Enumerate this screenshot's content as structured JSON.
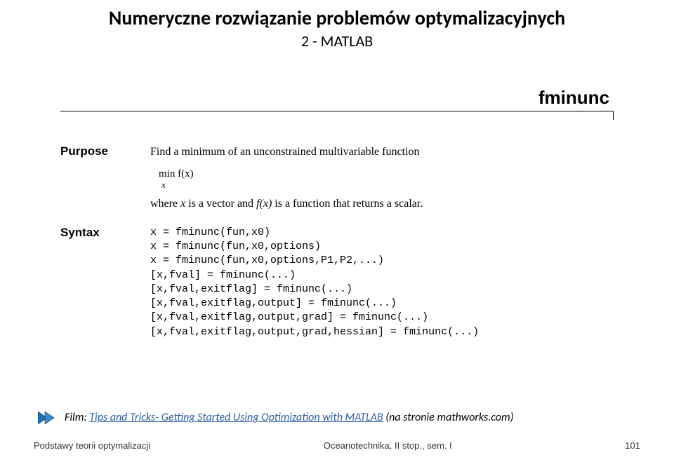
{
  "header": {
    "title": "Numeryczne rozwiązanie problemów optymalizacyjnych",
    "subtitle": "2 - MATLAB"
  },
  "doc": {
    "fn_name": "fminunc",
    "purpose_label": "Purpose",
    "purpose_text": "Find a minimum of an unconstrained multivariable function",
    "formula_top": "min  f(x)",
    "formula_sub": "x",
    "where_prefix": "where ",
    "where_x": "x",
    "where_mid": " is a vector and ",
    "where_fx": "f(x)",
    "where_suffix": " is a function that returns a scalar.",
    "syntax_label": "Syntax",
    "syntax_lines": "x = fminunc(fun,x0)\nx = fminunc(fun,x0,options)\nx = fminunc(fun,x0,options,P1,P2,...)\n[x,fval] = fminunc(...)\n[x,fval,exitflag] = fminunc(...)\n[x,fval,exitflag,output] = fminunc(...)\n[x,fval,exitflag,output,grad] = fminunc(...)\n[x,fval,exitflag,output,grad,hessian] = fminunc(...)"
  },
  "film": {
    "prefix": "Film: ",
    "link_text": "Tips and Tricks- Getting Started Using Optimization with MATLAB",
    "suffix": " (na stronie mathworks.com)"
  },
  "footer": {
    "left": "Podstawy teorii optymalizacji",
    "center": "Oceanotechnika, II stop., sem. I",
    "right": "101"
  }
}
